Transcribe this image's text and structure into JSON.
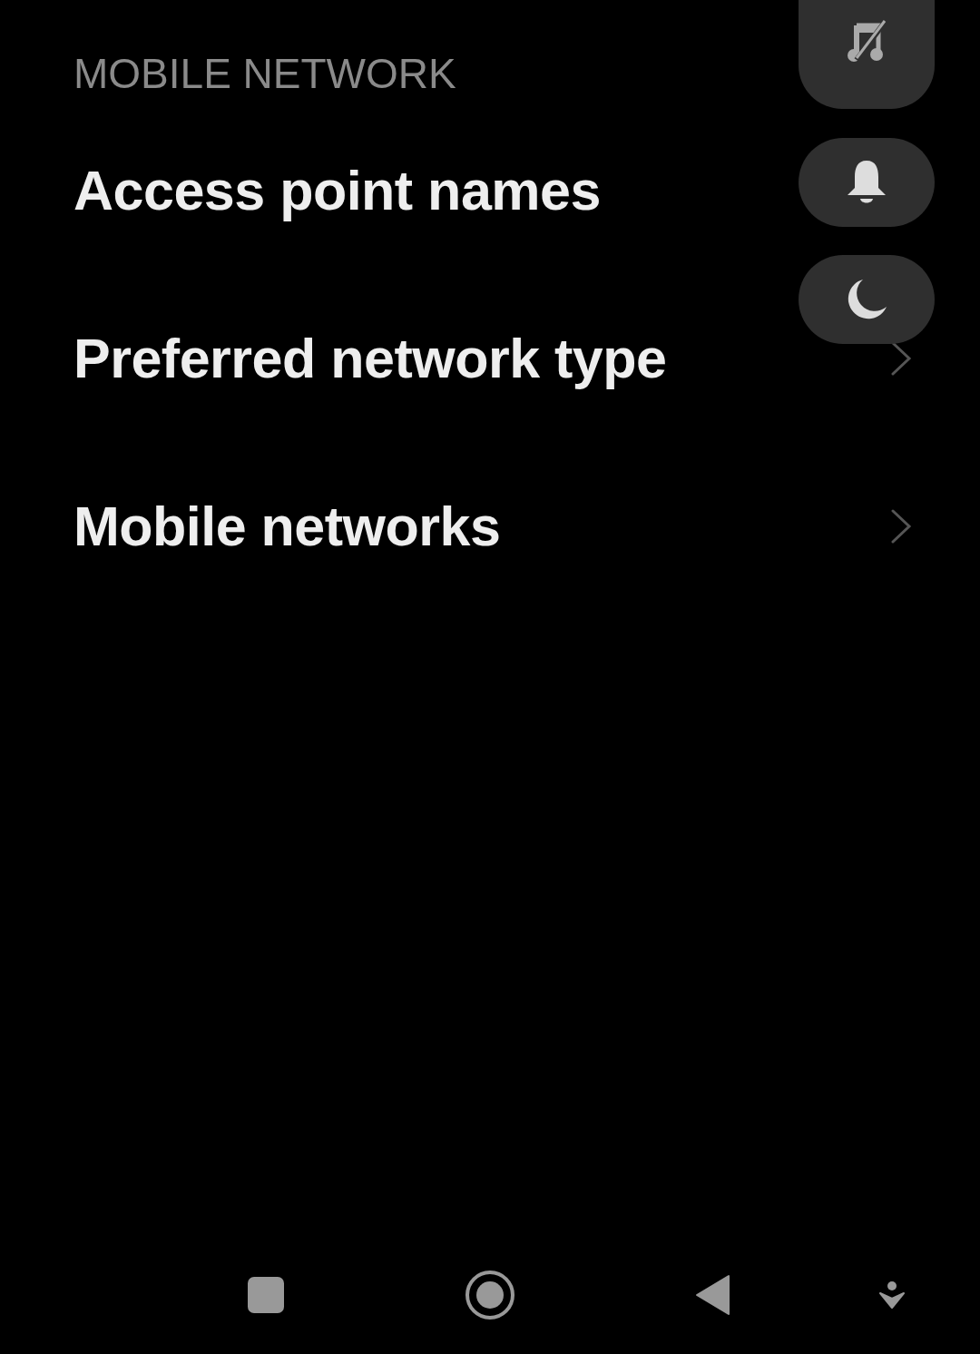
{
  "section": {
    "title": "MOBILE NETWORK"
  },
  "items": [
    {
      "label": "Access point names"
    },
    {
      "label": "Preferred network type"
    },
    {
      "label": "Mobile networks"
    }
  ]
}
